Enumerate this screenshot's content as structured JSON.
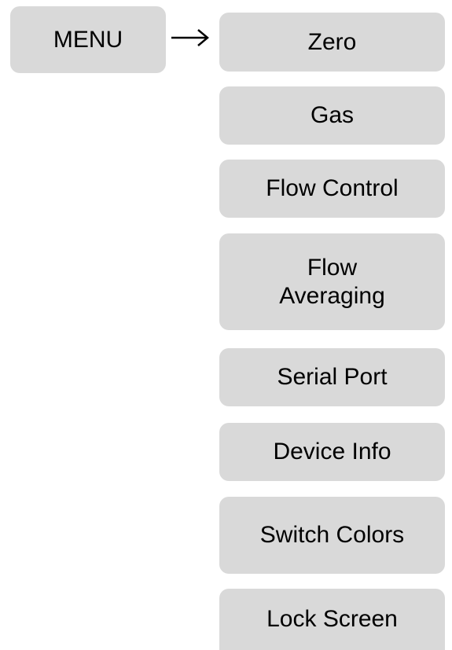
{
  "menu": {
    "label": "MENU",
    "arrow": "→"
  },
  "options": [
    {
      "label": "Zero"
    },
    {
      "label": "Gas"
    },
    {
      "label": "Flow Control"
    },
    {
      "label": "Flow\nAveraging"
    },
    {
      "label": "Serial Port"
    },
    {
      "label": "Device Info"
    },
    {
      "label": "Switch Colors"
    },
    {
      "label": "Lock Screen"
    }
  ],
  "colors": {
    "box_fill": "#d9d9d9",
    "text": "#000000",
    "background": "#ffffff"
  }
}
